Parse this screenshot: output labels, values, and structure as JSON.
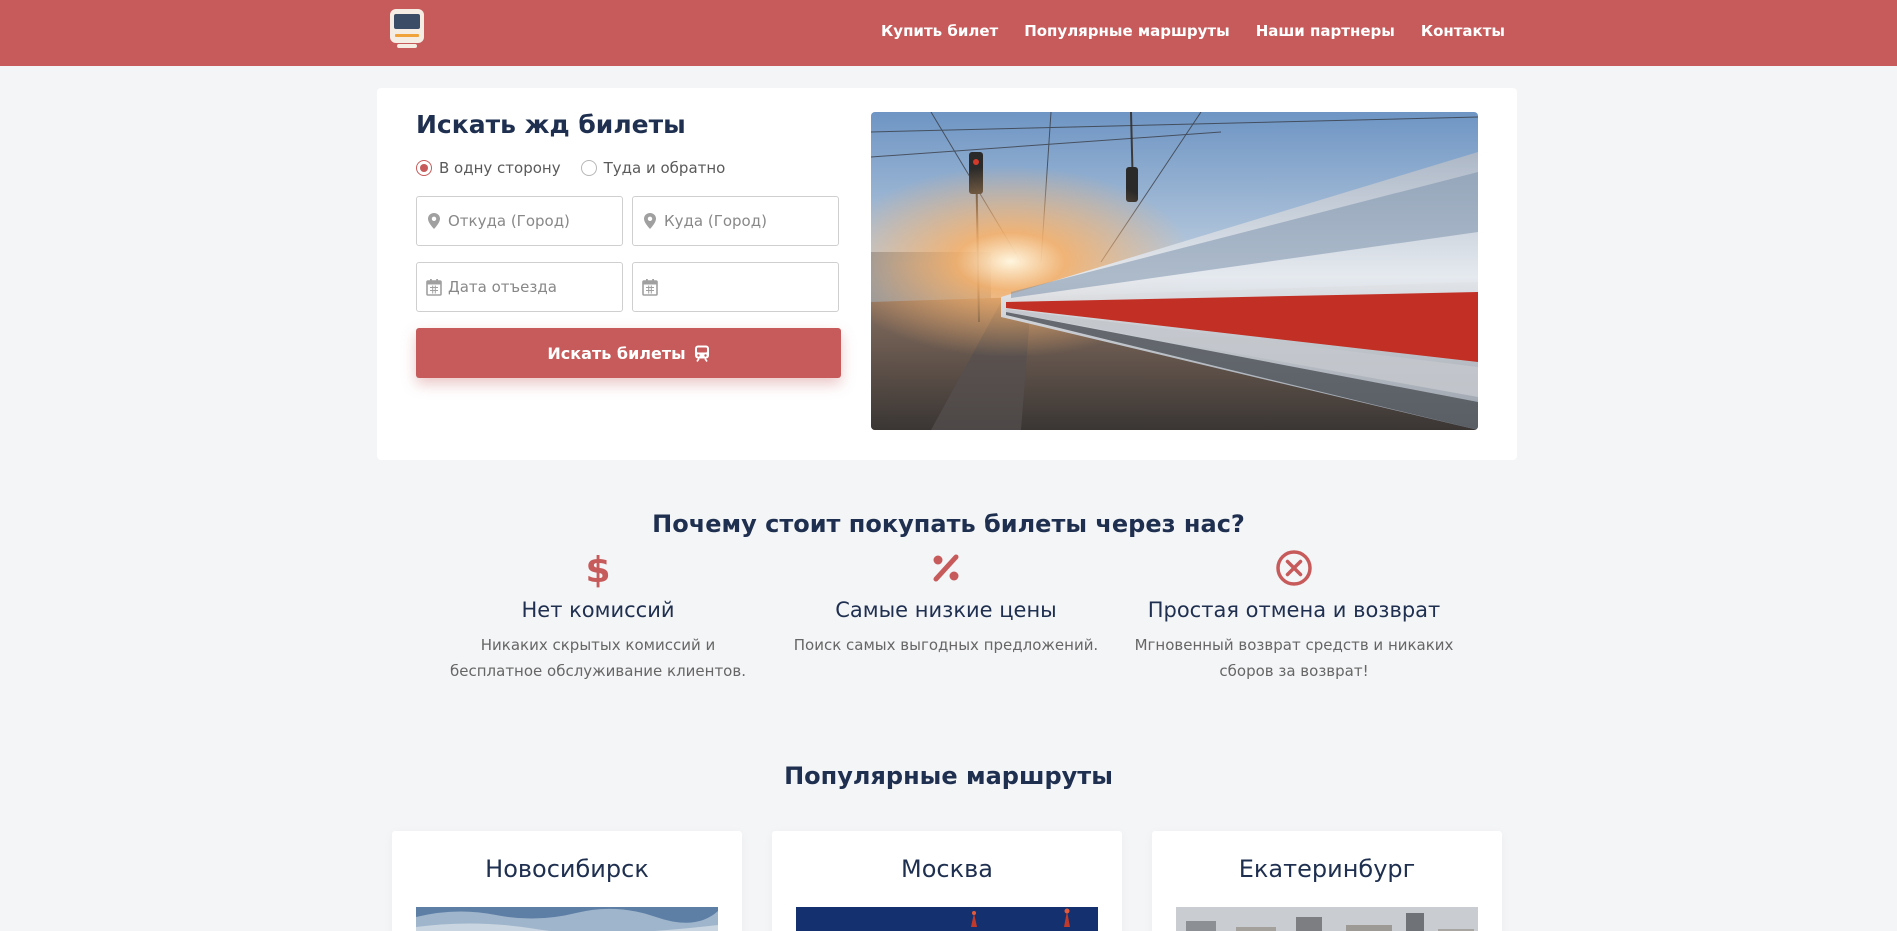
{
  "nav": {
    "logo_icon": "train-icon",
    "links": [
      "Купить билет",
      "Популярные маршруты",
      "Наши партнеры",
      "Контакты"
    ]
  },
  "search": {
    "title": "Искать жд билеты",
    "trip_options": [
      "В одну сторону",
      "Туда и обратно"
    ],
    "selected_trip": "В одну сторону",
    "from_placeholder": "Откуда (Город)",
    "to_placeholder": "Куда (Город)",
    "depart_placeholder": "Дата отъезда",
    "return_placeholder": "",
    "button_label": "Искать билеты"
  },
  "benefits": {
    "title": "Почему стоит покупать билеты через нас?",
    "items": [
      {
        "icon": "dollar-icon",
        "title": "Нет комиссий",
        "text": "Никаких скрытых комиссий и бесплатное обслуживание клиентов."
      },
      {
        "icon": "percent-icon",
        "title": "Самые низкие цены",
        "text": "Поиск самых выгодных предложений."
      },
      {
        "icon": "cancel-circle-icon",
        "title": "Простая отмена и возврат",
        "text": "Мгновенный возврат средств и никаких сборов за возврат!"
      }
    ]
  },
  "routes": {
    "title": "Популярные маршруты",
    "items": [
      "Новосибирск",
      "Москва",
      "Екатеринбург"
    ]
  },
  "colors": {
    "brand": "#c75b5b",
    "heading": "#1e2f4f",
    "background": "#f4f5f7"
  }
}
